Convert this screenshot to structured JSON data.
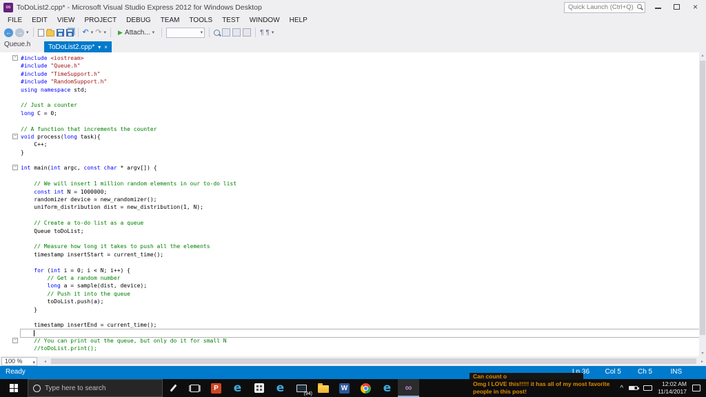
{
  "window": {
    "title": "ToDoList2.cpp* - Microsoft Visual Studio Express 2012 for Windows Desktop",
    "quick_launch": "Quick Launch (Ctrl+Q)"
  },
  "menu": {
    "items": [
      "FILE",
      "EDIT",
      "VIEW",
      "PROJECT",
      "DEBUG",
      "TEAM",
      "TOOLS",
      "TEST",
      "WINDOW",
      "HELP"
    ]
  },
  "toolbar": {
    "attach_label": "Attach..."
  },
  "tabs": {
    "inactive": "Queue.h",
    "active": "ToDoList2.cpp*"
  },
  "editor": {
    "zoom": "100 %",
    "cursor_line": 36,
    "fold_lines": [
      1,
      11,
      15,
      37
    ],
    "colors": {
      "k": "#0000ff",
      "c": "#008000",
      "s": "#a31515",
      "p": "#000000"
    },
    "lines": [
      [
        [
          "k",
          "#include"
        ],
        [
          "p",
          " "
        ],
        [
          "s",
          "<iostream>"
        ]
      ],
      [
        [
          "k",
          "#include"
        ],
        [
          "p",
          " "
        ],
        [
          "s",
          "\"Queue.h\""
        ]
      ],
      [
        [
          "k",
          "#include"
        ],
        [
          "p",
          " "
        ],
        [
          "s",
          "\"TimeSupport.h\""
        ]
      ],
      [
        [
          "k",
          "#include"
        ],
        [
          "p",
          " "
        ],
        [
          "s",
          "\"RandomSupport.h\""
        ]
      ],
      [
        [
          "k",
          "using"
        ],
        [
          "p",
          " "
        ],
        [
          "k",
          "namespace"
        ],
        [
          "p",
          " std;"
        ]
      ],
      [],
      [
        [
          "c",
          "// Just a counter"
        ]
      ],
      [
        [
          "k",
          "long"
        ],
        [
          "p",
          " C = 0;"
        ]
      ],
      [],
      [
        [
          "c",
          "// A function that increments the counter"
        ]
      ],
      [
        [
          "k",
          "void"
        ],
        [
          "p",
          " process("
        ],
        [
          "k",
          "long"
        ],
        [
          "p",
          " task){"
        ]
      ],
      [
        [
          "p",
          "    C++;"
        ]
      ],
      [
        [
          "p",
          "}"
        ]
      ],
      [],
      [
        [
          "k",
          "int"
        ],
        [
          "p",
          " main("
        ],
        [
          "k",
          "int"
        ],
        [
          "p",
          " argc, "
        ],
        [
          "k",
          "const"
        ],
        [
          "p",
          " "
        ],
        [
          "k",
          "char"
        ],
        [
          "p",
          " * argv[]) {"
        ]
      ],
      [],
      [
        [
          "p",
          "    "
        ],
        [
          "c",
          "// We will insert 1 million random elements in our to-do list"
        ]
      ],
      [
        [
          "p",
          "    "
        ],
        [
          "k",
          "const"
        ],
        [
          "p",
          " "
        ],
        [
          "k",
          "int"
        ],
        [
          "p",
          " N = 1000000;"
        ]
      ],
      [
        [
          "p",
          "    randomizer device = new_randomizer();"
        ]
      ],
      [
        [
          "p",
          "    uniform_distribution dist = new_distribution(1, N);"
        ]
      ],
      [],
      [
        [
          "p",
          "    "
        ],
        [
          "c",
          "// Create a to-do list as a queue"
        ]
      ],
      [
        [
          "p",
          "    Queue toDoList;"
        ]
      ],
      [],
      [
        [
          "p",
          "    "
        ],
        [
          "c",
          "// Measure how long it takes to push all the elements"
        ]
      ],
      [
        [
          "p",
          "    timestamp insertStart = current_time();"
        ]
      ],
      [],
      [
        [
          "p",
          "    "
        ],
        [
          "k",
          "for"
        ],
        [
          "p",
          " ("
        ],
        [
          "k",
          "int"
        ],
        [
          "p",
          " i = 0; i < N; i++) {"
        ]
      ],
      [
        [
          "p",
          "        "
        ],
        [
          "c",
          "// Get a random number"
        ]
      ],
      [
        [
          "p",
          "        "
        ],
        [
          "k",
          "long"
        ],
        [
          "p",
          " a = sample(dist, device);"
        ]
      ],
      [
        [
          "p",
          "        "
        ],
        [
          "c",
          "// Push it into the queue"
        ]
      ],
      [
        [
          "p",
          "        toDoList.push(a);"
        ]
      ],
      [
        [
          "p",
          "    }"
        ]
      ],
      [],
      [
        [
          "p",
          "    timestamp insertEnd = current_time();"
        ]
      ],
      [],
      [
        [
          "p",
          "    "
        ],
        [
          "c",
          "// You can print out the queue, but only do it for small N"
        ]
      ],
      [
        [
          "p",
          "    "
        ],
        [
          "c",
          "//toDoList.print();"
        ]
      ]
    ]
  },
  "status_bar": {
    "state": "Ready",
    "line": "Ln 36",
    "column": "Col 5",
    "character": "Ch 5",
    "mode": "INS"
  },
  "taskbar": {
    "search_placeholder": "Type here to search",
    "badge": "(94)",
    "clock_time": "12:02 AM",
    "clock_date": "11/14/2017"
  },
  "overlay": {
    "lines": [
      "Can count o",
      "Omg I LOVE this!!!!! it has all of my most favorite",
      "people in this post!"
    ]
  },
  "icons": {
    "back_arrow": "←",
    "forward_arrow": "→",
    "dropdown_caret": "▾",
    "undo": "↶",
    "redo": "↷",
    "play": "▶",
    "close": "×",
    "minus": "−",
    "scroll_up": "▴",
    "scroll_down": "▾",
    "scroll_left": "◂",
    "scroll_right": "▸",
    "powerpoint_letter": "P",
    "word_letter": "W",
    "edge_letter": "e",
    "vs_infinity": "∞",
    "tray_chevron": "^",
    "paragraph": "¶"
  }
}
